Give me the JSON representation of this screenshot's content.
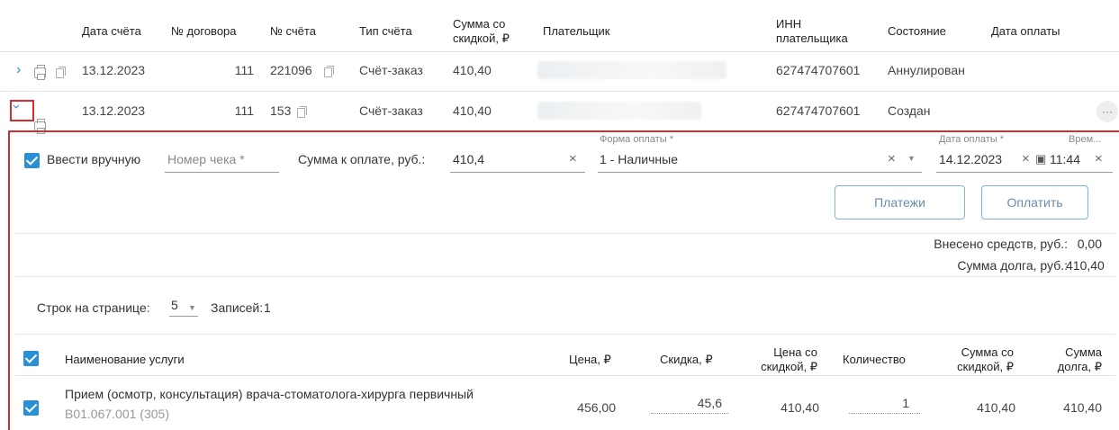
{
  "invoices_table": {
    "headers": {
      "date": "Дата счёта",
      "contract": "№ договора",
      "invoice_no": "№ счёта",
      "type": "Тип счёта",
      "sum_discount": "Сумма со скидкой, ₽",
      "payer": "Плательщик",
      "inn": "ИНН плательщика",
      "state": "Состояние",
      "pay_date": "Дата оплаты"
    },
    "rows": [
      {
        "date": "13.12.2023",
        "contract": "111",
        "invoice_no": "221096",
        "type": "Счёт-заказ",
        "sum": "410,40",
        "inn": "627474707601",
        "state": "Аннулирован",
        "expanded": false
      },
      {
        "date": "13.12.2023",
        "contract": "111",
        "invoice_no": "153",
        "type": "Счёт-заказ",
        "sum": "410,40",
        "inn": "627474707601",
        "state": "Создан",
        "expanded": true
      }
    ],
    "more_label": "···"
  },
  "payment_form": {
    "manual_label": "Ввести вручную",
    "manual_checked": true,
    "receipt_placeholder": "Номер чека *",
    "amount_label": "Сумма к оплате, руб.:",
    "amount_value": "410,4",
    "pay_form_label": "Форма оплаты *",
    "pay_form_value": "1 - Наличные",
    "pay_date_label": "Дата оплаты *",
    "pay_date_value": "14.12.2023",
    "time_label": "Врем...",
    "time_value": "11:44",
    "payments_button": "Платежи",
    "pay_button": "Оплатить",
    "deposited_label": "Внесено средств, руб.:",
    "deposited_value": "0,00",
    "debt_label": "Сумма долга, руб.:",
    "debt_value": "410,40"
  },
  "pagination": {
    "rows_label": "Строк на странице:",
    "rows_value": "5",
    "records_label": "Записей:",
    "records_value": "1"
  },
  "services_table": {
    "headers": {
      "name": "Наименование услуги",
      "price": "Цена, ₽",
      "discount": "Скидка, ₽",
      "price_discount": "Цена со скидкой, ₽",
      "qty": "Количество",
      "sum_discount": "Сумма со скидкой, ₽",
      "debt": "Сумма долга, ₽"
    },
    "rows": [
      {
        "name": "Прием (осмотр, консультация) врача-стоматолога-хирурга первичный",
        "code": "B01.067.001 (305)",
        "price": "456,00",
        "discount": "45,6",
        "price_discount": "410,40",
        "qty": "1",
        "sum_discount": "410,40",
        "debt": "410,40"
      }
    ]
  },
  "colors": {
    "accent": "#2b8fd6",
    "highlight_border": "#d32f2f",
    "button_border": "#7fb3d9"
  }
}
